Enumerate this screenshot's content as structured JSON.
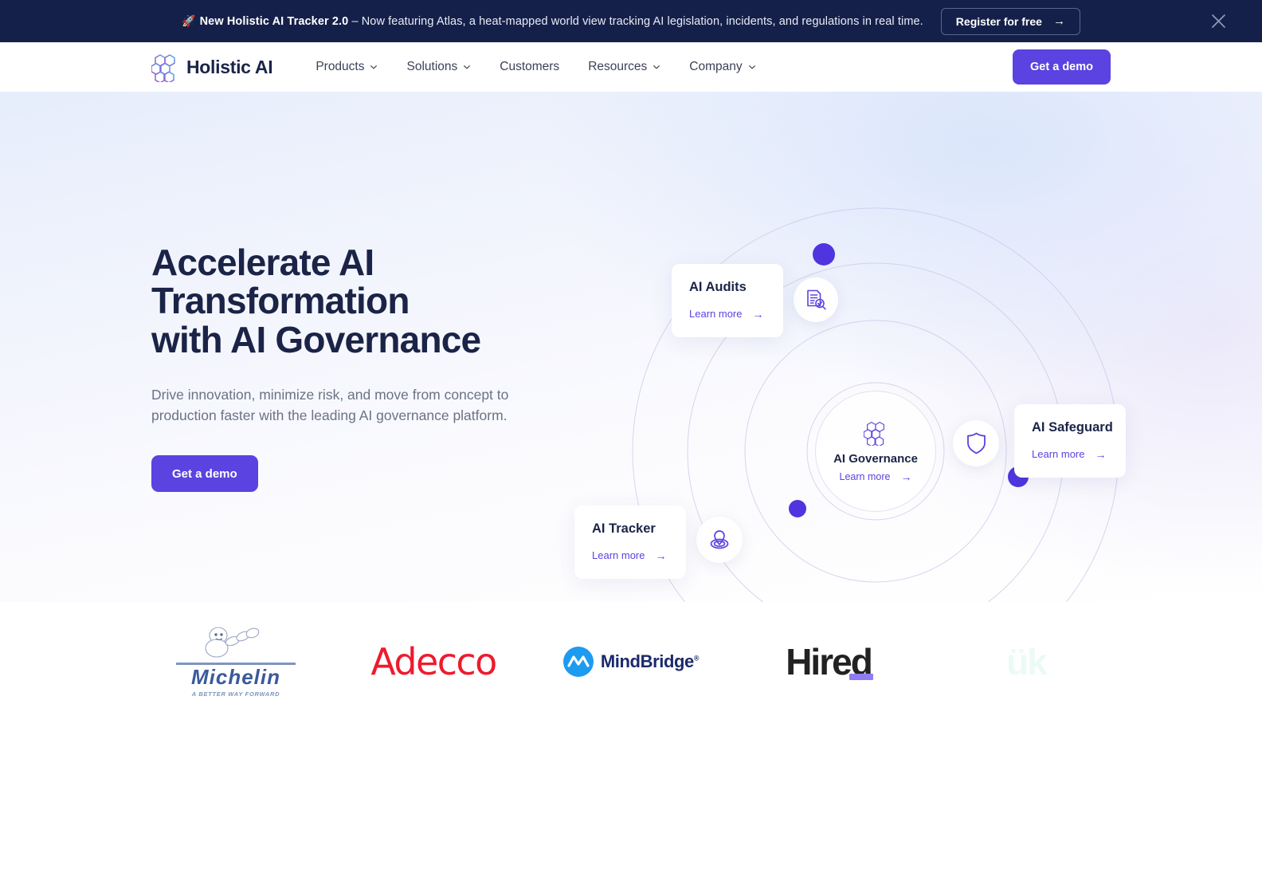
{
  "announcement": {
    "icon": "rocket-icon",
    "emoji": "🚀",
    "headline": "New Holistic AI Tracker 2.0",
    "body": " – Now featuring Atlas, a heat-mapped world view tracking AI legislation, incidents, and regulations in real time.",
    "button_label": "Register for free",
    "button_arrow": "→",
    "close_icon": "close-icon",
    "bg_color": "#15204a"
  },
  "nav": {
    "brand": "Holistic AI",
    "logo_icon": "holistic-ai-lattice-logo",
    "items": [
      {
        "label": "Products",
        "has_dropdown": true
      },
      {
        "label": "Solutions",
        "has_dropdown": true
      },
      {
        "label": "Customers",
        "has_dropdown": false
      },
      {
        "label": "Resources",
        "has_dropdown": true
      },
      {
        "label": "Company",
        "has_dropdown": true
      }
    ],
    "cta_label": "Get a demo",
    "cta_color": "#5a43e0"
  },
  "hero": {
    "heading_line1": "Accelerate AI Transformation",
    "heading_line2": "with AI Governance",
    "subheading": "Drive innovation, minimize risk, and move from concept to production faster with the leading AI governance platform.",
    "cta_label": "Get a demo",
    "heading_color": "#1b2447",
    "subheading_color": "#6b7285"
  },
  "orbit": {
    "center": {
      "title": "AI Governance",
      "learn_more": "Learn more",
      "arrow": "→",
      "icon": "holistic-ai-lattice-logo"
    },
    "cards": [
      {
        "title": "AI Audits",
        "learn_more": "Learn more",
        "arrow": "→",
        "icon": "document-audit-icon"
      },
      {
        "title": "AI Safeguard",
        "learn_more": "Learn more",
        "arrow": "→",
        "icon": "shield-icon"
      },
      {
        "title": "AI Tracker",
        "learn_more": "Learn more",
        "arrow": "→",
        "icon": "map-pin-icon"
      }
    ],
    "accent_color": "#5a43e0",
    "dot_color": "#4f35df"
  },
  "logos": {
    "items": [
      {
        "name": "Michelin",
        "tagline": "A BETTER WAY FORWARD",
        "color": "#3b5a9c"
      },
      {
        "name": "Adecco",
        "color": "#ed1b2e"
      },
      {
        "name": "MindBridge",
        "color": "#1b2a6b"
      },
      {
        "name": "Hired",
        "color": "#222222",
        "accent": "#8f7cf0"
      },
      {
        "name": "ük",
        "color": "#4bd1b0",
        "faded": true
      }
    ]
  }
}
